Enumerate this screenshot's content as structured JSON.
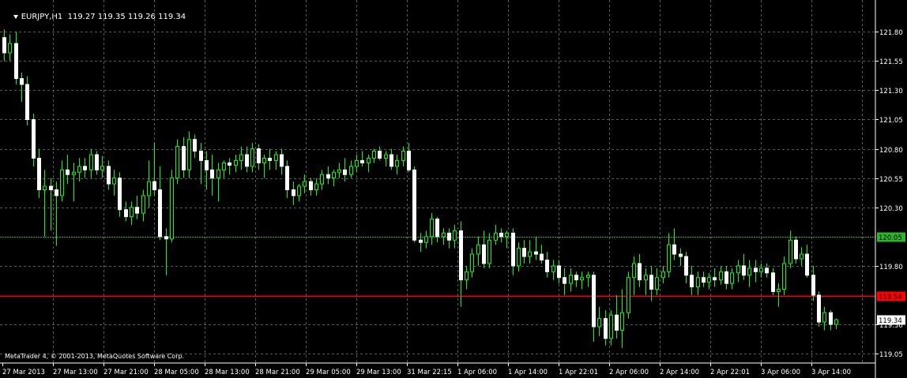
{
  "header": {
    "symbol": "EURJPY,H1",
    "ohlc": "119.27 119.35 119.26 119.34"
  },
  "footer": {
    "copyright": "MetaTrader 4, © 2001-2013, MetaQuotes Software Corp."
  },
  "colors": {
    "background": "#000000",
    "grid": "#5a5a5a",
    "candle_body": "#ffffff",
    "candle_wick": "#00ff00",
    "axis_text": "#ffffff",
    "green_level_line": "#2bb52b",
    "red_level_line": "#ff0000",
    "bid_label_bg": "#ffffff"
  },
  "chart_data": {
    "type": "candlestick",
    "ylim": [
      118.97,
      121.95
    ],
    "y_ticks": [
      "121.80",
      "121.55",
      "121.30",
      "121.05",
      "120.80",
      "120.55",
      "120.30",
      "119.80",
      "119.30",
      "119.05"
    ],
    "x_ticks": [
      "27 Mar 2013",
      "27 Mar 13:00",
      "27 Mar 21:00",
      "28 Mar 05:00",
      "28 Mar 13:00",
      "28 Mar 21:00",
      "29 Mar 05:00",
      "29 Mar 13:00",
      "31 Mar 22:15",
      "1 Apr 06:00",
      "1 Apr 14:00",
      "1 Apr 22:01",
      "2 Apr 06:00",
      "2 Apr 14:00",
      "2 Apr 22:01",
      "3 Apr 06:00",
      "3 Apr 14:00"
    ],
    "levels": [
      {
        "price": 120.05,
        "label": "120.05",
        "color": "green"
      },
      {
        "price": 119.54,
        "label": "119.54",
        "color": "red"
      }
    ],
    "bid": {
      "price": 119.34,
      "label": "119.34"
    },
    "candles": [
      {
        "o": 121.75,
        "h": 121.82,
        "l": 121.55,
        "c": 121.62
      },
      {
        "o": 121.62,
        "h": 121.78,
        "l": 121.55,
        "c": 121.7
      },
      {
        "o": 121.7,
        "h": 121.8,
        "l": 121.35,
        "c": 121.4
      },
      {
        "o": 121.4,
        "h": 121.45,
        "l": 121.2,
        "c": 121.35
      },
      {
        "o": 121.35,
        "h": 121.42,
        "l": 121.0,
        "c": 121.05
      },
      {
        "o": 121.05,
        "h": 121.1,
        "l": 120.65,
        "c": 120.72
      },
      {
        "o": 120.72,
        "h": 120.8,
        "l": 120.38,
        "c": 120.45
      },
      {
        "o": 120.45,
        "h": 120.62,
        "l": 120.05,
        "c": 120.48
      },
      {
        "o": 120.48,
        "h": 120.55,
        "l": 120.1,
        "c": 120.45
      },
      {
        "o": 120.45,
        "h": 120.52,
        "l": 119.97,
        "c": 120.4
      },
      {
        "o": 120.4,
        "h": 120.7,
        "l": 120.35,
        "c": 120.62
      },
      {
        "o": 120.62,
        "h": 120.75,
        "l": 120.5,
        "c": 120.58
      },
      {
        "o": 120.58,
        "h": 120.68,
        "l": 120.35,
        "c": 120.6
      },
      {
        "o": 120.6,
        "h": 120.72,
        "l": 120.52,
        "c": 120.65
      },
      {
        "o": 120.65,
        "h": 120.72,
        "l": 120.55,
        "c": 120.62
      },
      {
        "o": 120.62,
        "h": 120.8,
        "l": 120.55,
        "c": 120.75
      },
      {
        "o": 120.75,
        "h": 120.78,
        "l": 120.58,
        "c": 120.62
      },
      {
        "o": 120.62,
        "h": 120.74,
        "l": 120.55,
        "c": 120.65
      },
      {
        "o": 120.65,
        "h": 120.7,
        "l": 120.45,
        "c": 120.5
      },
      {
        "o": 120.5,
        "h": 120.62,
        "l": 120.4,
        "c": 120.55
      },
      {
        "o": 120.55,
        "h": 120.6,
        "l": 120.22,
        "c": 120.28
      },
      {
        "o": 120.28,
        "h": 120.35,
        "l": 120.18,
        "c": 120.22
      },
      {
        "o": 120.22,
        "h": 120.35,
        "l": 120.15,
        "c": 120.3
      },
      {
        "o": 120.3,
        "h": 120.4,
        "l": 120.2,
        "c": 120.25
      },
      {
        "o": 120.25,
        "h": 120.45,
        "l": 120.18,
        "c": 120.4
      },
      {
        "o": 120.4,
        "h": 120.7,
        "l": 120.3,
        "c": 120.52
      },
      {
        "o": 120.52,
        "h": 120.85,
        "l": 120.4,
        "c": 120.45
      },
      {
        "o": 120.45,
        "h": 120.65,
        "l": 120.02,
        "c": 120.05
      },
      {
        "o": 120.05,
        "h": 120.12,
        "l": 119.72,
        "c": 120.03
      },
      {
        "o": 120.03,
        "h": 120.62,
        "l": 120.0,
        "c": 120.55
      },
      {
        "o": 120.55,
        "h": 120.88,
        "l": 120.5,
        "c": 120.82
      },
      {
        "o": 120.82,
        "h": 120.9,
        "l": 120.55,
        "c": 120.62
      },
      {
        "o": 120.62,
        "h": 120.95,
        "l": 120.55,
        "c": 120.88
      },
      {
        "o": 120.88,
        "h": 120.92,
        "l": 120.72,
        "c": 120.78
      },
      {
        "o": 120.78,
        "h": 120.85,
        "l": 120.5,
        "c": 120.7
      },
      {
        "o": 120.7,
        "h": 120.78,
        "l": 120.45,
        "c": 120.62
      },
      {
        "o": 120.62,
        "h": 120.75,
        "l": 120.4,
        "c": 120.55
      },
      {
        "o": 120.55,
        "h": 120.68,
        "l": 120.35,
        "c": 120.62
      },
      {
        "o": 120.62,
        "h": 120.7,
        "l": 120.55,
        "c": 120.68
      },
      {
        "o": 120.68,
        "h": 120.72,
        "l": 120.58,
        "c": 120.66
      },
      {
        "o": 120.66,
        "h": 120.75,
        "l": 120.6,
        "c": 120.7
      },
      {
        "o": 120.7,
        "h": 120.82,
        "l": 120.62,
        "c": 120.75
      },
      {
        "o": 120.75,
        "h": 120.82,
        "l": 120.6,
        "c": 120.65
      },
      {
        "o": 120.65,
        "h": 120.85,
        "l": 120.6,
        "c": 120.8
      },
      {
        "o": 120.8,
        "h": 120.84,
        "l": 120.62,
        "c": 120.68
      },
      {
        "o": 120.68,
        "h": 120.75,
        "l": 120.55,
        "c": 120.72
      },
      {
        "o": 120.72,
        "h": 120.8,
        "l": 120.62,
        "c": 120.7
      },
      {
        "o": 120.7,
        "h": 120.78,
        "l": 120.62,
        "c": 120.75
      },
      {
        "o": 120.75,
        "h": 120.8,
        "l": 120.58,
        "c": 120.65
      },
      {
        "o": 120.65,
        "h": 120.7,
        "l": 120.38,
        "c": 120.45
      },
      {
        "o": 120.45,
        "h": 120.52,
        "l": 120.32,
        "c": 120.4
      },
      {
        "o": 120.4,
        "h": 120.5,
        "l": 120.35,
        "c": 120.48
      },
      {
        "o": 120.48,
        "h": 120.58,
        "l": 120.42,
        "c": 120.52
      },
      {
        "o": 120.52,
        "h": 120.55,
        "l": 120.4,
        "c": 120.45
      },
      {
        "o": 120.45,
        "h": 120.55,
        "l": 120.4,
        "c": 120.5
      },
      {
        "o": 120.5,
        "h": 120.62,
        "l": 120.45,
        "c": 120.58
      },
      {
        "o": 120.58,
        "h": 120.65,
        "l": 120.5,
        "c": 120.55
      },
      {
        "o": 120.55,
        "h": 120.62,
        "l": 120.48,
        "c": 120.6
      },
      {
        "o": 120.6,
        "h": 120.68,
        "l": 120.55,
        "c": 120.62
      },
      {
        "o": 120.62,
        "h": 120.72,
        "l": 120.52,
        "c": 120.58
      },
      {
        "o": 120.58,
        "h": 120.7,
        "l": 120.55,
        "c": 120.65
      },
      {
        "o": 120.65,
        "h": 120.75,
        "l": 120.6,
        "c": 120.7
      },
      {
        "o": 120.7,
        "h": 120.78,
        "l": 120.65,
        "c": 120.68
      },
      {
        "o": 120.68,
        "h": 120.75,
        "l": 120.6,
        "c": 120.72
      },
      {
        "o": 120.72,
        "h": 120.8,
        "l": 120.68,
        "c": 120.78
      },
      {
        "o": 120.78,
        "h": 120.82,
        "l": 120.7,
        "c": 120.72
      },
      {
        "o": 120.72,
        "h": 120.78,
        "l": 120.65,
        "c": 120.75
      },
      {
        "o": 120.75,
        "h": 120.8,
        "l": 120.62,
        "c": 120.65
      },
      {
        "o": 120.65,
        "h": 120.75,
        "l": 120.58,
        "c": 120.7
      },
      {
        "o": 120.7,
        "h": 120.82,
        "l": 120.65,
        "c": 120.78
      },
      {
        "o": 120.78,
        "h": 120.85,
        "l": 120.6,
        "c": 120.62
      },
      {
        "o": 120.62,
        "h": 120.65,
        "l": 120.0,
        "c": 120.02
      },
      {
        "o": 120.02,
        "h": 120.08,
        "l": 119.92,
        "c": 120.0
      },
      {
        "o": 120.0,
        "h": 120.1,
        "l": 119.95,
        "c": 120.05
      },
      {
        "o": 120.05,
        "h": 120.25,
        "l": 119.98,
        "c": 120.2
      },
      {
        "o": 120.2,
        "h": 120.22,
        "l": 120.0,
        "c": 120.05
      },
      {
        "o": 120.05,
        "h": 120.12,
        "l": 119.98,
        "c": 120.08
      },
      {
        "o": 120.08,
        "h": 120.12,
        "l": 119.95,
        "c": 120.02
      },
      {
        "o": 120.02,
        "h": 120.15,
        "l": 119.95,
        "c": 120.1
      },
      {
        "o": 120.1,
        "h": 120.18,
        "l": 119.45,
        "c": 119.68
      },
      {
        "o": 119.68,
        "h": 119.8,
        "l": 119.6,
        "c": 119.75
      },
      {
        "o": 119.75,
        "h": 119.95,
        "l": 119.7,
        "c": 119.9
      },
      {
        "o": 119.9,
        "h": 120.05,
        "l": 119.8,
        "c": 119.98
      },
      {
        "o": 119.98,
        "h": 120.1,
        "l": 119.78,
        "c": 119.82
      },
      {
        "o": 119.82,
        "h": 120.08,
        "l": 119.78,
        "c": 120.02
      },
      {
        "o": 120.02,
        "h": 120.15,
        "l": 119.98,
        "c": 120.08
      },
      {
        "o": 120.08,
        "h": 120.12,
        "l": 120.0,
        "c": 120.05
      },
      {
        "o": 120.05,
        "h": 120.1,
        "l": 119.95,
        "c": 120.08
      },
      {
        "o": 120.08,
        "h": 120.12,
        "l": 119.72,
        "c": 119.8
      },
      {
        "o": 119.8,
        "h": 120.0,
        "l": 119.75,
        "c": 119.95
      },
      {
        "o": 119.95,
        "h": 120.02,
        "l": 119.82,
        "c": 119.88
      },
      {
        "o": 119.88,
        "h": 120.02,
        "l": 119.82,
        "c": 119.92
      },
      {
        "o": 119.92,
        "h": 120.05,
        "l": 119.85,
        "c": 119.9
      },
      {
        "o": 119.9,
        "h": 119.98,
        "l": 119.82,
        "c": 119.85
      },
      {
        "o": 119.85,
        "h": 119.92,
        "l": 119.7,
        "c": 119.75
      },
      {
        "o": 119.75,
        "h": 119.85,
        "l": 119.68,
        "c": 119.8
      },
      {
        "o": 119.8,
        "h": 119.85,
        "l": 119.65,
        "c": 119.7
      },
      {
        "o": 119.7,
        "h": 119.78,
        "l": 119.55,
        "c": 119.65
      },
      {
        "o": 119.65,
        "h": 119.78,
        "l": 119.58,
        "c": 119.72
      },
      {
        "o": 119.72,
        "h": 119.75,
        "l": 119.62,
        "c": 119.68
      },
      {
        "o": 119.68,
        "h": 119.75,
        "l": 119.6,
        "c": 119.7
      },
      {
        "o": 119.7,
        "h": 119.75,
        "l": 119.62,
        "c": 119.72
      },
      {
        "o": 119.72,
        "h": 119.75,
        "l": 119.15,
        "c": 119.28
      },
      {
        "o": 119.28,
        "h": 119.45,
        "l": 119.2,
        "c": 119.35
      },
      {
        "o": 119.35,
        "h": 119.42,
        "l": 119.12,
        "c": 119.18
      },
      {
        "o": 119.18,
        "h": 119.42,
        "l": 119.12,
        "c": 119.38
      },
      {
        "o": 119.38,
        "h": 119.55,
        "l": 119.18,
        "c": 119.25
      },
      {
        "o": 119.25,
        "h": 119.6,
        "l": 119.1,
        "c": 119.4
      },
      {
        "o": 119.4,
        "h": 119.75,
        "l": 119.35,
        "c": 119.7
      },
      {
        "o": 119.7,
        "h": 119.88,
        "l": 119.55,
        "c": 119.82
      },
      {
        "o": 119.82,
        "h": 119.9,
        "l": 119.62,
        "c": 119.68
      },
      {
        "o": 119.68,
        "h": 119.78,
        "l": 119.55,
        "c": 119.72
      },
      {
        "o": 119.72,
        "h": 119.8,
        "l": 119.5,
        "c": 119.6
      },
      {
        "o": 119.6,
        "h": 119.78,
        "l": 119.55,
        "c": 119.7
      },
      {
        "o": 119.7,
        "h": 119.8,
        "l": 119.65,
        "c": 119.75
      },
      {
        "o": 119.75,
        "h": 120.08,
        "l": 119.7,
        "c": 119.98
      },
      {
        "o": 119.98,
        "h": 120.12,
        "l": 119.85,
        "c": 119.9
      },
      {
        "o": 119.9,
        "h": 119.95,
        "l": 119.8,
        "c": 119.88
      },
      {
        "o": 119.88,
        "h": 119.92,
        "l": 119.65,
        "c": 119.72
      },
      {
        "o": 119.72,
        "h": 119.8,
        "l": 119.55,
        "c": 119.62
      },
      {
        "o": 119.62,
        "h": 119.75,
        "l": 119.55,
        "c": 119.7
      },
      {
        "o": 119.7,
        "h": 119.75,
        "l": 119.62,
        "c": 119.66
      },
      {
        "o": 119.66,
        "h": 119.74,
        "l": 119.6,
        "c": 119.7
      },
      {
        "o": 119.7,
        "h": 119.78,
        "l": 119.62,
        "c": 119.68
      },
      {
        "o": 119.68,
        "h": 119.8,
        "l": 119.64,
        "c": 119.75
      },
      {
        "o": 119.75,
        "h": 119.8,
        "l": 119.6,
        "c": 119.65
      },
      {
        "o": 119.65,
        "h": 119.78,
        "l": 119.6,
        "c": 119.74
      },
      {
        "o": 119.74,
        "h": 119.85,
        "l": 119.66,
        "c": 119.8
      },
      {
        "o": 119.8,
        "h": 119.9,
        "l": 119.68,
        "c": 119.72
      },
      {
        "o": 119.72,
        "h": 119.85,
        "l": 119.62,
        "c": 119.78
      },
      {
        "o": 119.78,
        "h": 119.85,
        "l": 119.66,
        "c": 119.75
      },
      {
        "o": 119.75,
        "h": 119.82,
        "l": 119.7,
        "c": 119.78
      },
      {
        "o": 119.78,
        "h": 119.82,
        "l": 119.7,
        "c": 119.74
      },
      {
        "o": 119.74,
        "h": 119.78,
        "l": 119.55,
        "c": 119.58
      },
      {
        "o": 119.58,
        "h": 119.65,
        "l": 119.45,
        "c": 119.6
      },
      {
        "o": 119.6,
        "h": 119.88,
        "l": 119.55,
        "c": 119.82
      },
      {
        "o": 119.82,
        "h": 120.1,
        "l": 119.78,
        "c": 120.02
      },
      {
        "o": 120.02,
        "h": 120.05,
        "l": 119.82,
        "c": 119.86
      },
      {
        "o": 119.86,
        "h": 119.96,
        "l": 119.8,
        "c": 119.9
      },
      {
        "o": 119.9,
        "h": 119.98,
        "l": 119.7,
        "c": 119.72
      },
      {
        "o": 119.72,
        "h": 119.8,
        "l": 119.5,
        "c": 119.55
      },
      {
        "o": 119.55,
        "h": 119.58,
        "l": 119.28,
        "c": 119.32
      },
      {
        "o": 119.32,
        "h": 119.45,
        "l": 119.25,
        "c": 119.4
      },
      {
        "o": 119.4,
        "h": 119.42,
        "l": 119.25,
        "c": 119.3
      },
      {
        "o": 119.3,
        "h": 119.35,
        "l": 119.26,
        "c": 119.34
      }
    ]
  }
}
